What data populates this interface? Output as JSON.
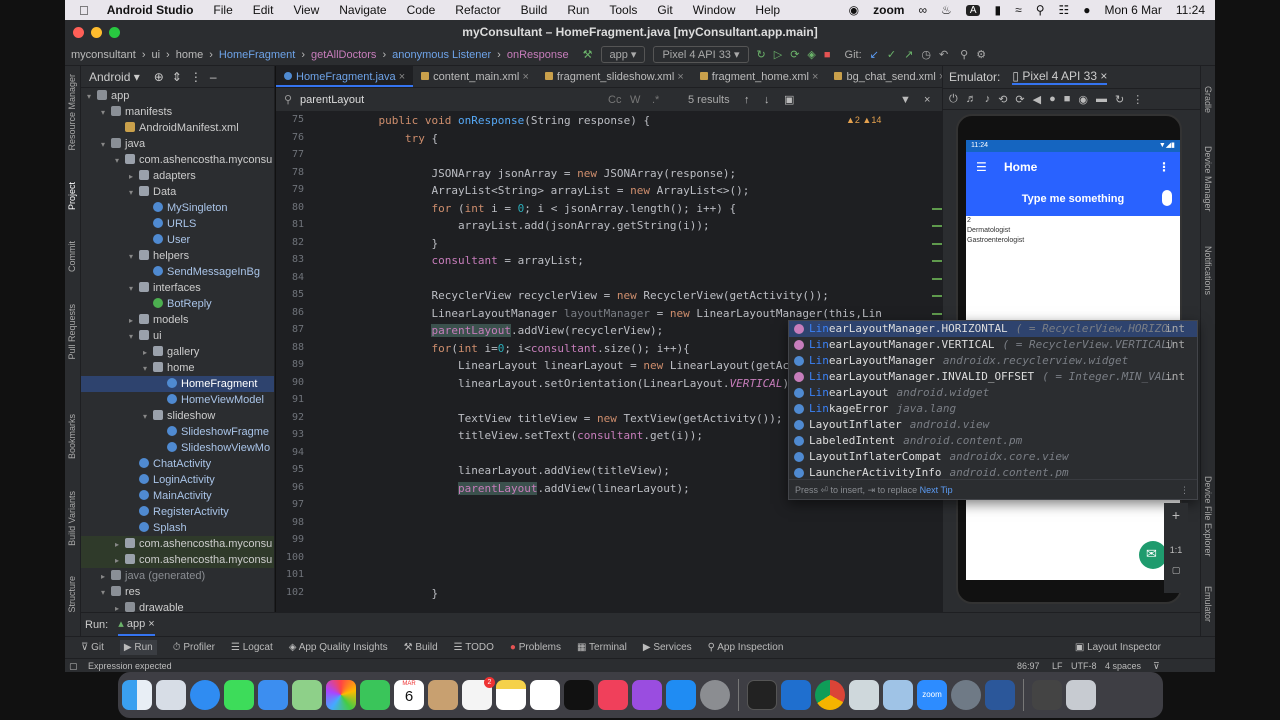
{
  "menubar": {
    "app": "Android Studio",
    "items": [
      "File",
      "Edit",
      "View",
      "Navigate",
      "Code",
      "Refactor",
      "Build",
      "Run",
      "Tools",
      "Git",
      "Window",
      "Help"
    ],
    "zoom_label": "zoom",
    "date": "Mon 6 Mar",
    "time": "11:24",
    "a_key": "A"
  },
  "window": {
    "title": "myConsultant – HomeFragment.java [myConsultant.app.main]"
  },
  "breadcrumbs": [
    "myconsultant",
    "ui",
    "home",
    "HomeFragment",
    "getAllDoctors",
    "anonymous Listener",
    "onResponse"
  ],
  "toolbar": {
    "run_config": "app",
    "device": "Pixel 4 API 33",
    "git_label": "Git:"
  },
  "project": {
    "view_label": "Android",
    "tree": [
      {
        "label": "app",
        "depth": 0,
        "icon": "folder",
        "arrow": "▾"
      },
      {
        "label": "manifests",
        "depth": 1,
        "icon": "folder",
        "arrow": "▾"
      },
      {
        "label": "AndroidManifest.xml",
        "depth": 2,
        "icon": "xml",
        "arrow": ""
      },
      {
        "label": "java",
        "depth": 1,
        "icon": "folder",
        "arrow": "▾"
      },
      {
        "label": "com.ashencostha.myconsu",
        "depth": 2,
        "icon": "pkg",
        "arrow": "▾"
      },
      {
        "label": "adapters",
        "depth": 3,
        "icon": "pkg",
        "arrow": "▸"
      },
      {
        "label": "Data",
        "depth": 3,
        "icon": "pkg",
        "arrow": "▾"
      },
      {
        "label": "MySingleton",
        "depth": 4,
        "icon": "cls",
        "arrow": ""
      },
      {
        "label": "URLS",
        "depth": 4,
        "icon": "cls",
        "arrow": ""
      },
      {
        "label": "User",
        "depth": 4,
        "icon": "cls",
        "arrow": ""
      },
      {
        "label": "helpers",
        "depth": 3,
        "icon": "pkg",
        "arrow": "▾"
      },
      {
        "label": "SendMessageInBg",
        "depth": 4,
        "icon": "cls",
        "arrow": ""
      },
      {
        "label": "interfaces",
        "depth": 3,
        "icon": "pkg",
        "arrow": "▾"
      },
      {
        "label": "BotReply",
        "depth": 4,
        "icon": "itf",
        "arrow": ""
      },
      {
        "label": "models",
        "depth": 3,
        "icon": "pkg",
        "arrow": "▸"
      },
      {
        "label": "ui",
        "depth": 3,
        "icon": "pkg",
        "arrow": "▾"
      },
      {
        "label": "gallery",
        "depth": 4,
        "icon": "pkg",
        "arrow": "▸"
      },
      {
        "label": "home",
        "depth": 4,
        "icon": "pkg",
        "arrow": "▾"
      },
      {
        "label": "HomeFragment",
        "depth": 5,
        "icon": "cls",
        "arrow": "",
        "selected": true
      },
      {
        "label": "HomeViewModel",
        "depth": 5,
        "icon": "cls",
        "arrow": ""
      },
      {
        "label": "slideshow",
        "depth": 4,
        "icon": "pkg",
        "arrow": "▾"
      },
      {
        "label": "SlideshowFragme",
        "depth": 5,
        "icon": "cls",
        "arrow": ""
      },
      {
        "label": "SlideshowViewMo",
        "depth": 5,
        "icon": "cls",
        "arrow": ""
      },
      {
        "label": "ChatActivity",
        "depth": 3,
        "icon": "cls",
        "arrow": ""
      },
      {
        "label": "LoginActivity",
        "depth": 3,
        "icon": "cls",
        "arrow": ""
      },
      {
        "label": "MainActivity",
        "depth": 3,
        "icon": "cls",
        "arrow": ""
      },
      {
        "label": "RegisterActivity",
        "depth": 3,
        "icon": "cls",
        "arrow": ""
      },
      {
        "label": "Splash",
        "depth": 3,
        "icon": "cls",
        "arrow": ""
      },
      {
        "label": "com.ashencostha.myconsu",
        "depth": 2,
        "icon": "pkg",
        "arrow": "▸",
        "hl": true
      },
      {
        "label": "com.ashencostha.myconsu",
        "depth": 2,
        "icon": "pkg",
        "arrow": "▸",
        "hl": true
      },
      {
        "label": "java (generated)",
        "depth": 1,
        "icon": "folder",
        "arrow": "▸"
      },
      {
        "label": "res",
        "depth": 1,
        "icon": "folder",
        "arrow": "▾"
      },
      {
        "label": "drawable",
        "depth": 2,
        "icon": "folder",
        "arrow": "▸"
      }
    ]
  },
  "side_tabs_left": [
    "Resource Manager",
    "Project",
    "Commit",
    "Pull Requests",
    "Bookmarks",
    "Build Variants",
    "Structure"
  ],
  "side_tabs_right": [
    "Gradle",
    "Device Manager",
    "Notifications",
    "Device File Explorer",
    "Emulator"
  ],
  "editor": {
    "tabs": [
      "HomeFragment.java",
      "content_main.xml",
      "fragment_slideshow.xml",
      "fragment_home.xml",
      "bg_chat_send.xml"
    ],
    "find_query": "parentLayout",
    "find_results": "5 results",
    "inspection": "▲2 ▲14",
    "line_numbers": [
      "75",
      "76",
      "77",
      "78",
      "79",
      "80",
      "81",
      "82",
      "83",
      "84",
      "85",
      "86",
      "87",
      "88",
      "89",
      "90",
      "91",
      "92",
      "93",
      "94",
      "95",
      "96",
      "97",
      "98",
      "99",
      "100",
      "101",
      "102"
    ],
    "code_lines": [
      "    public void onResponse(String response) {",
      "        try {",
      "",
      "            JSONArray jsonArray = new JSONArray(response);",
      "            ArrayList<String> arrayList = new ArrayList<>();",
      "            for (int i = 0; i < jsonArray.length(); i++) {",
      "                arrayList.add(jsonArray.getString(i));",
      "            }",
      "            consultant = arrayList;",
      "",
      "            RecyclerView recyclerView = new RecyclerView(getActivity());",
      "            LinearLayoutManager layoutManager = new LinearLayoutManager(this,Lin",
      "            parentLayout.addView(recyclerView);",
      "            for(int i=0; i<consultant.size(); i++){",
      "                LinearLayout linearLayout = new LinearLayout(getActivity()",
      "                linearLayout.setOrientation(LinearLayout.VERTICAL);",
      "",
      "                TextView titleView = new TextView(getActivity());",
      "                titleView.setText(consultant.get(i));",
      "",
      "                linearLayout.addView(titleView);",
      "                parentLayout.addView(linearLayout);",
      "",
      "",
      "",
      "",
      "",
      "            }"
    ]
  },
  "completion": {
    "items": [
      {
        "prefix": "Lin",
        "rest": "earLayoutManager.HORIZONTAL",
        "tail": "( = RecyclerView.HORIZO…",
        "type": "int",
        "kind": "f"
      },
      {
        "prefix": "Lin",
        "rest": "earLayoutManager.VERTICAL",
        "tail": "( = RecyclerView.VERTICAL)",
        "type": "int",
        "kind": "f"
      },
      {
        "prefix": "Lin",
        "rest": "earLayoutManager",
        "tail": "androidx.recyclerview.widget",
        "type": "",
        "kind": "c"
      },
      {
        "prefix": "Lin",
        "rest": "earLayoutManager.INVALID_OFFSET",
        "tail": "( = Integer.MIN_VAL…",
        "type": "int",
        "kind": "f"
      },
      {
        "prefix": "Lin",
        "rest": "earLayout",
        "tail": "android.widget",
        "type": "",
        "kind": "c"
      },
      {
        "prefix": "Lin",
        "rest": "kageError",
        "tail": "java.lang",
        "type": "",
        "kind": "c"
      },
      {
        "prefix": "",
        "rest": "LayoutInflater",
        "tail": "android.view",
        "type": "",
        "kind": "c"
      },
      {
        "prefix": "",
        "rest": "LabeledIntent",
        "tail": "android.content.pm",
        "type": "",
        "kind": "c"
      },
      {
        "prefix": "",
        "rest": "LayoutInflaterCompat",
        "tail": "androidx.core.view",
        "type": "",
        "kind": "c"
      },
      {
        "prefix": "",
        "rest": "LauncherActivityInfo",
        "tail": "android.content.pm",
        "type": "",
        "kind": "c"
      }
    ],
    "footer": "Press ⏎ to insert, ⇥ to replace",
    "next_tip": "Next Tip"
  },
  "emulator": {
    "label": "Emulator:",
    "device_tab": "Pixel 4 API 33",
    "phone_time": "11:24",
    "app_title": "Home",
    "input_hint": "Type me something",
    "list": [
      "2",
      "Dermatologist",
      "Gastroenterologist"
    ],
    "zoom_ratio": "1:1",
    "plus": "+"
  },
  "run": {
    "label": "Run:",
    "config": "app"
  },
  "tool_windows": [
    "Git",
    "Run",
    "Profiler",
    "Logcat",
    "App Quality Insights",
    "Build",
    "TODO",
    "Problems",
    "Terminal",
    "Services",
    "App Inspection"
  ],
  "layout_inspector": "Layout Inspector",
  "status": {
    "message": "Expression expected",
    "position": "86:97",
    "line_sep": "LF",
    "encoding": "UTF-8",
    "indent": "4 spaces"
  },
  "dock": {
    "calendar_month": "MAR",
    "calendar_day": "6",
    "reminders_badge": "2",
    "zoom": "zoom"
  }
}
